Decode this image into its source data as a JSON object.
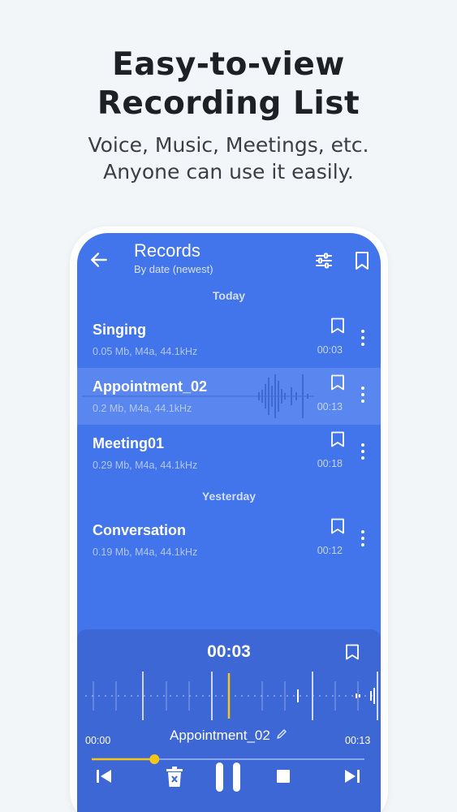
{
  "promo": {
    "headline_line1": "Easy-to-view",
    "headline_line2": "Recording List",
    "sub_line1": "Voice, Music, Meetings, etc.",
    "sub_line2": "Anyone can use it easily."
  },
  "appbar": {
    "title": "Records",
    "subtitle": "By date (newest)"
  },
  "sections": {
    "today": "Today",
    "yesterday": "Yesterday"
  },
  "records": [
    {
      "name": "Singing",
      "meta": "0.05 Mb, M4a, 44.1kHz",
      "duration": "00:03"
    },
    {
      "name": "Appointment_02",
      "meta": "0.2 Mb, M4a, 44.1kHz",
      "duration": "00:13"
    },
    {
      "name": "Meeting01",
      "meta": "0.29 Mb, M4a, 44.1kHz",
      "duration": "00:18"
    },
    {
      "name": "Conversation",
      "meta": "0.19 Mb, M4a, 44.1kHz",
      "duration": "00:12"
    }
  ],
  "player": {
    "current_time": "00:03",
    "start_time": "00:00",
    "end_time": "00:13",
    "track_name": "Appointment_02",
    "progress": 0.23
  },
  "colors": {
    "screen_bg": "#4274ec",
    "active_row": "#5a87ef",
    "player_bg": "#3e67d6",
    "accent": "#f5c518"
  },
  "icons": {
    "back": "arrow-left-icon",
    "filter": "sliders-icon",
    "bookmark": "bookmark-icon",
    "more": "more-vertical-icon",
    "edit": "pencil-icon",
    "prev": "skip-previous-icon",
    "delete": "trash-icon",
    "pause": "pause-icon",
    "stop": "stop-icon",
    "next": "skip-next-icon"
  }
}
